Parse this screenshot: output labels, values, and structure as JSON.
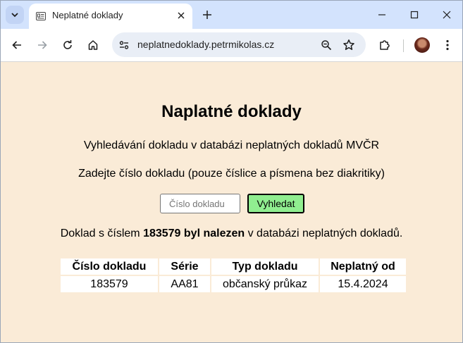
{
  "browser": {
    "tab_title": "Neplatné doklady",
    "url": "neplatnedoklady.petrmikolas.cz"
  },
  "page": {
    "heading": "Naplatné doklady",
    "subtitle": "Vyhledávání dokladu v databázi neplatných dokladů MVČR",
    "instruction": "Zadejte číslo dokladu (pouze číslice a písmena bez diakritiky)",
    "search": {
      "placeholder": "Číslo dokladu",
      "value": "",
      "button_label": "Vyhledat"
    },
    "result": {
      "prefix": "Doklad s číslem ",
      "emphasis": "183579 byl nalezen",
      "suffix": " v databázi neplatných dokladů."
    },
    "table": {
      "headers": [
        "Číslo dokladu",
        "Série",
        "Typ dokladu",
        "Neplatný od"
      ],
      "rows": [
        [
          "183579",
          "AA81",
          "občanský průkaz",
          "15.4.2024"
        ]
      ]
    }
  },
  "colors": {
    "page_background": "#faebd7",
    "button_background": "#90ee90"
  }
}
